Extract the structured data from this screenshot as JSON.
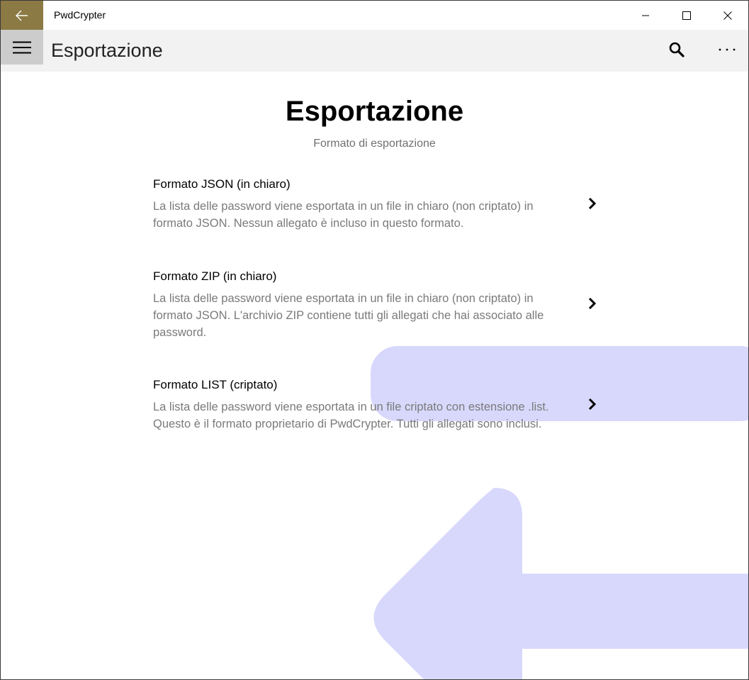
{
  "window": {
    "app_title": "PwdCrypter",
    "accent_color": "#8b7a44"
  },
  "header": {
    "title": "Esportazione",
    "menu_icon": "hamburger-icon",
    "search_icon": "search-icon",
    "more_icon": "more-icon"
  },
  "page": {
    "heading": "Esportazione",
    "subtitle": "Formato di esportazione"
  },
  "options": [
    {
      "title": "Formato JSON (in chiaro)",
      "description": "La lista delle password viene esportata in un file in chiaro (non criptato) in formato JSON. Nessun allegato è incluso in questo formato."
    },
    {
      "title": "Formato ZIP (in chiaro)",
      "description": "La lista delle password viene esportata in un file in chiaro (non criptato) in formato JSON. L'archivio ZIP contiene tutti gli allegati che hai associato alle password."
    },
    {
      "title": "Formato LIST (criptato)",
      "description": "La lista delle password viene esportata in un file criptato con estensione .list. Questo è il formato proprietario di PwdCrypter. Tutti gli allegati sono inclusi."
    }
  ],
  "decoration_color": "#d8d8fc"
}
